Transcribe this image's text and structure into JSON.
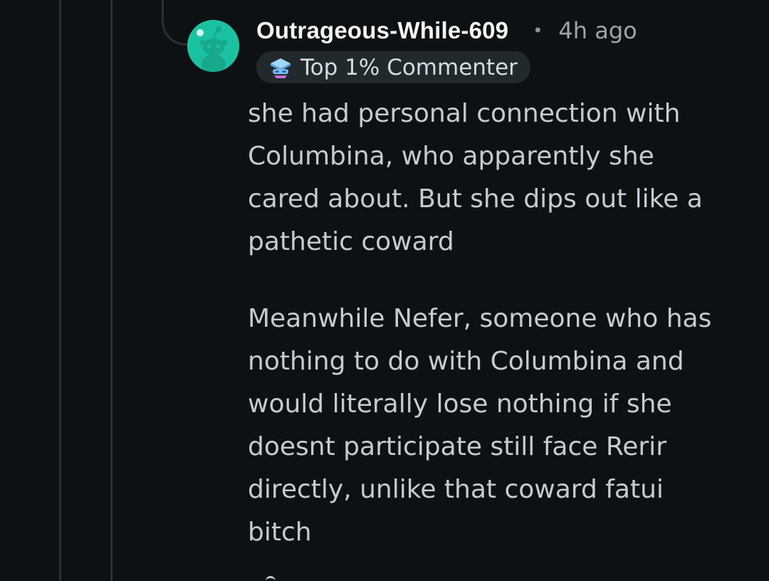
{
  "comment": {
    "author": "Outrageous-While-609",
    "separator": "•",
    "timestamp": "4h ago",
    "badge": {
      "icon": "top-commenter-badge-icon",
      "label": "Top 1% Commenter"
    },
    "paragraphs": [
      "she had personal connection with Columbina, who apparently she cared about. But she dips out like a pathetic coward",
      "Meanwhile Nefer, someone who has nothing to do with Columbina and would literally lose nothing if she doesnt participate still face Rerir directly, unlike that coward fatui bitch"
    ]
  },
  "colors": {
    "background": "#0e1113",
    "avatar": "#1bc2a1",
    "thread_line": "#2a3034",
    "badge_bg": "#22292d"
  }
}
